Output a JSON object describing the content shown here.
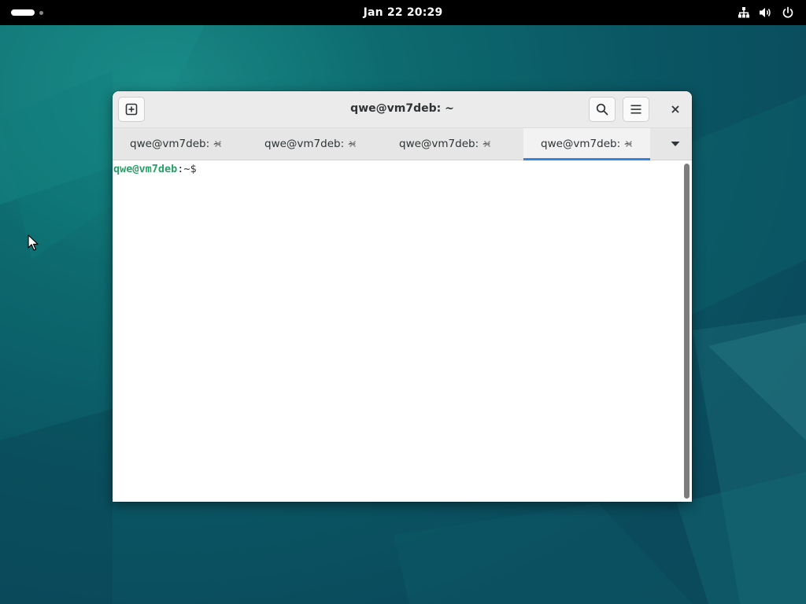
{
  "topbar": {
    "clock": "Jan 22  20:29",
    "icons": [
      "network-wired-icon",
      "volume-icon",
      "power-icon"
    ]
  },
  "window": {
    "title": "qwe@vm7deb: ~",
    "buttons": {
      "new_tab": "new-tab-icon",
      "search": "search-icon",
      "menu": "hamburger-menu-icon",
      "close": "close-icon"
    },
    "tabs": [
      {
        "label": "qwe@vm7deb: ~",
        "active": false
      },
      {
        "label": "qwe@vm7deb: ~",
        "active": false
      },
      {
        "label": "qwe@vm7deb: ~",
        "active": false
      },
      {
        "label": "qwe@vm7deb: ~",
        "active": true
      }
    ],
    "terminal": {
      "prompt_user": "qwe@vm7deb",
      "prompt_path": ":~$"
    }
  },
  "colors": {
    "accent": "#3584e4",
    "prompt_user": "#26a269",
    "topbar": "#000000",
    "desktop": "#0b5563"
  }
}
